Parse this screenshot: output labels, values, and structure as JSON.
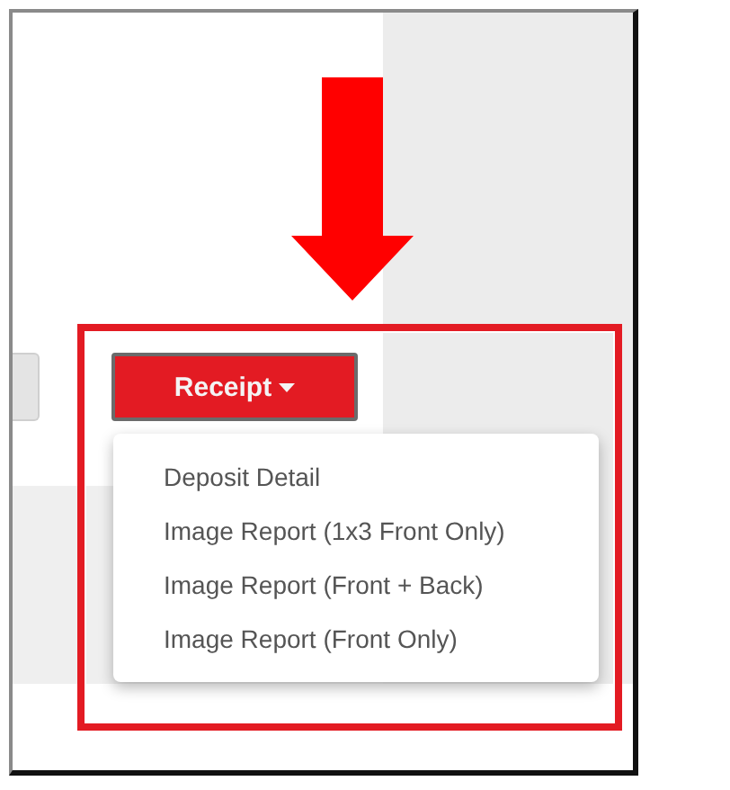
{
  "receipt_button": {
    "label": "Receipt",
    "expanded": true
  },
  "menu": {
    "items": [
      {
        "label": "Deposit Detail"
      },
      {
        "label": "Image Report (1x3 Front Only)"
      },
      {
        "label": "Image Report (Front + Back)"
      },
      {
        "label": "Image Report (Front Only)"
      }
    ]
  }
}
